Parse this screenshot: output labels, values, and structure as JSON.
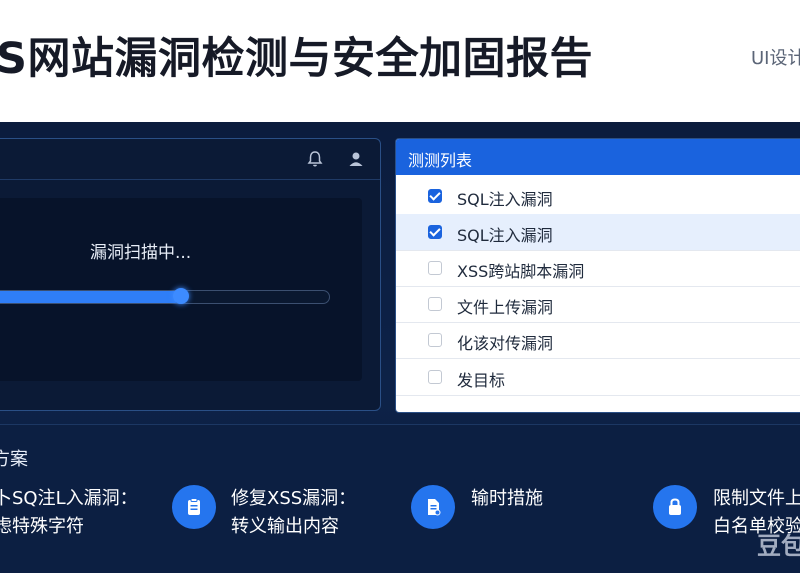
{
  "header": {
    "title": "S网站漏洞检测与安全加固报告",
    "tag": "UI设计"
  },
  "scanner": {
    "status_text": "漏洞扫描中...",
    "progress_fraction": 0.56,
    "icons": [
      "bell-icon",
      "user-icon"
    ]
  },
  "test_list": {
    "title": "测测列表",
    "items": [
      {
        "label": "SQL注入漏洞",
        "checked": true
      },
      {
        "label": "SQL注入漏洞",
        "checked": true,
        "selected": true
      },
      {
        "label": "XSS跨站脚本漏洞",
        "checked": false
      },
      {
        "label": "文件上传漏洞",
        "checked": false
      },
      {
        "label": "化该对传漏洞",
        "checked": false
      },
      {
        "label": "发目标",
        "checked": false
      }
    ]
  },
  "fix_plan": {
    "title": "方案",
    "items": [
      {
        "lines": [
          "卜SQ注L入漏洞：",
          "虑特殊字符"
        ],
        "icon": null
      },
      {
        "lines": [
          "修复XSS漏洞：",
          "转义输出内容"
        ],
        "icon": "clipboard-icon"
      },
      {
        "lines": [
          "输时措施",
          ""
        ],
        "icon": "document-icon"
      },
      {
        "lines": [
          "限制文件上",
          "白名单校验"
        ],
        "icon": "lock-icon"
      }
    ]
  },
  "watermark": "豆包",
  "colors": {
    "accent": "#1a63de",
    "background": "#0b1c3d",
    "progress": "#2f7ef7"
  }
}
